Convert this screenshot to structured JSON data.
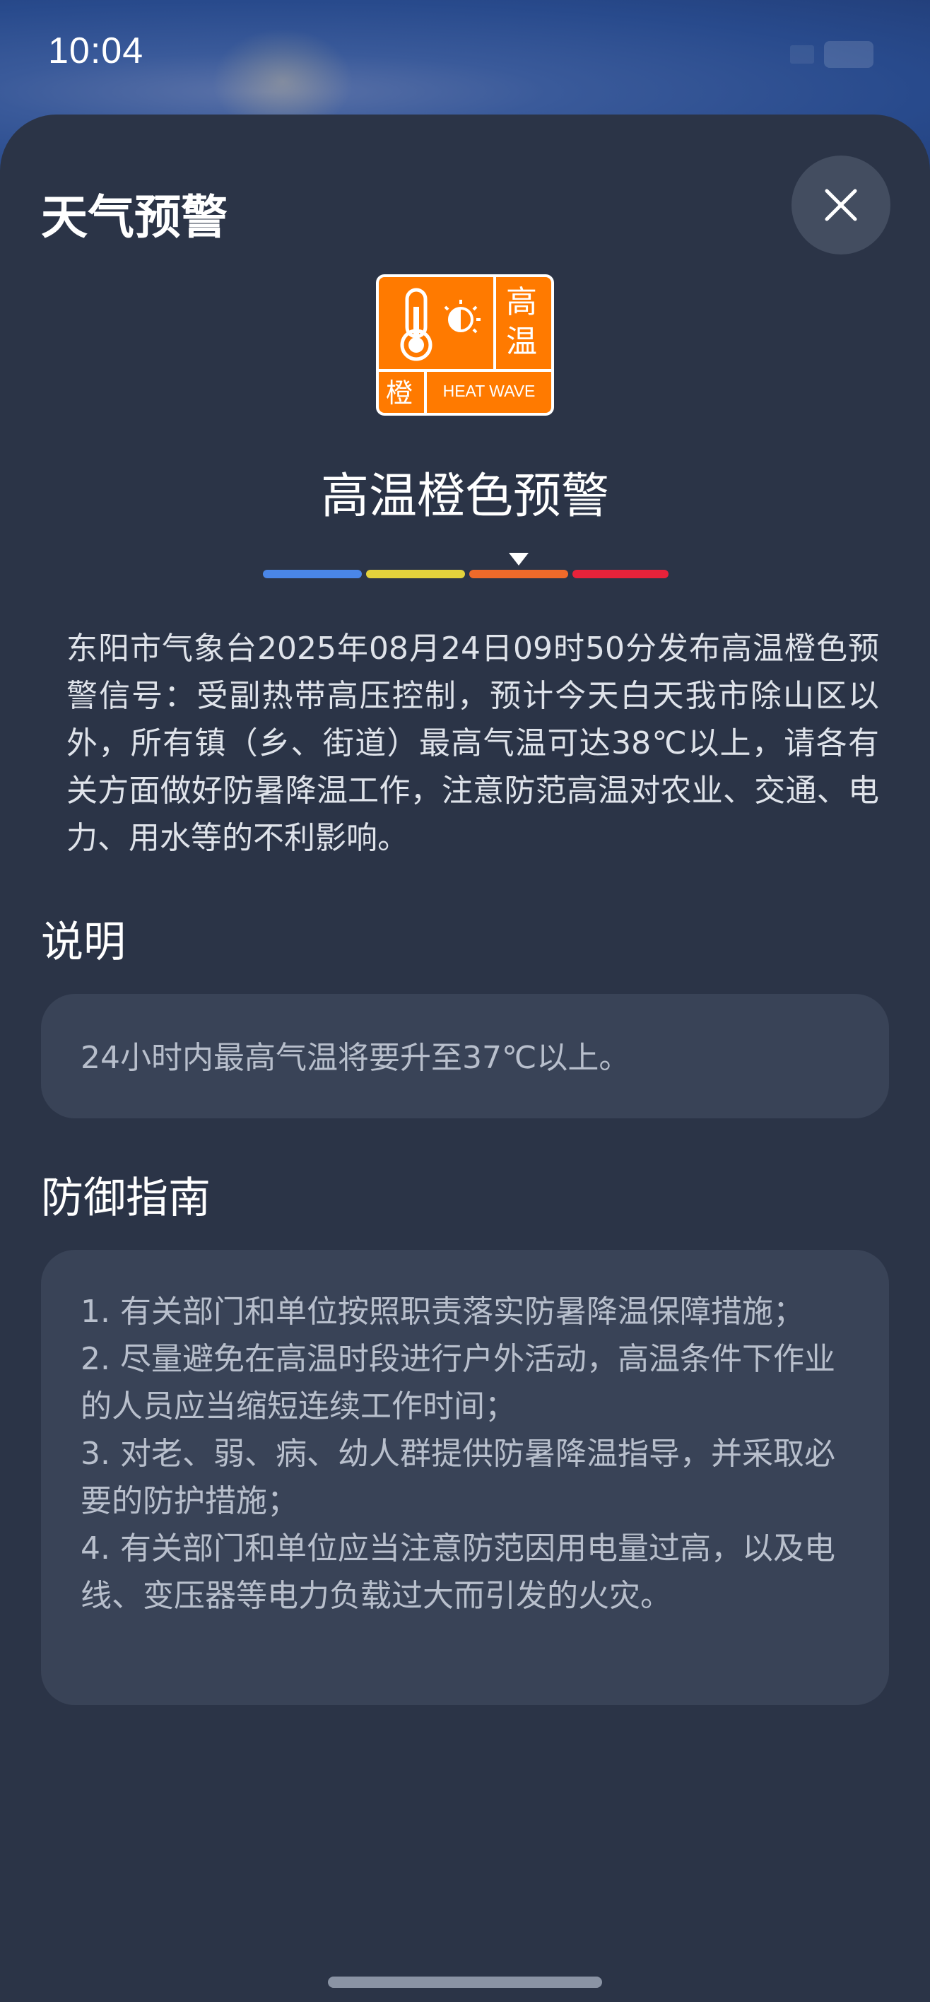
{
  "status_bar": {
    "time": "10:04"
  },
  "sheet": {
    "title": "天气预警",
    "close_icon": "close-icon"
  },
  "warning": {
    "badge": {
      "char_top": "高",
      "char_bottom": "温",
      "char_level": "橙",
      "english": "HEAT WAVE",
      "icon": "thermometer-sun-icon",
      "color": "#ff7a00"
    },
    "name": "高温橙色预警",
    "level": {
      "segments": [
        {
          "name": "blue",
          "color": "#4a86e8"
        },
        {
          "name": "yellow",
          "color": "#e3d23c"
        },
        {
          "name": "orange",
          "color": "#ef6a2a"
        },
        {
          "name": "red",
          "color": "#e8223a"
        }
      ],
      "current_index": 2
    },
    "description": "东阳市气象台2025年08月24日09时50分发布高温橙色预警信号：受副热带高压控制，预计今天白天我市除山区以外，所有镇（乡、街道）最高气温可达38℃以上，请各有关方面做好防暑降温工作，注意防范高温对农业、交通、电力、用水等的不利影响。"
  },
  "explanation": {
    "heading": "说明",
    "text": "24小时内最高气温将要升至37℃以上。"
  },
  "guide": {
    "heading": "防御指南",
    "items": [
      "1. 有关部门和单位按照职责落实防暑降温保障措施；",
      "2. 尽量避免在高温时段进行户外活动，高温条件下作业的人员应当缩短连续工作时间；",
      "3. 对老、弱、病、幼人群提供防暑降温指导，并采取必要的防护措施；",
      "4. 有关部门和单位应当注意防范因用电量过高，以及电线、变压器等电力负载过大而引发的火灾。"
    ]
  }
}
